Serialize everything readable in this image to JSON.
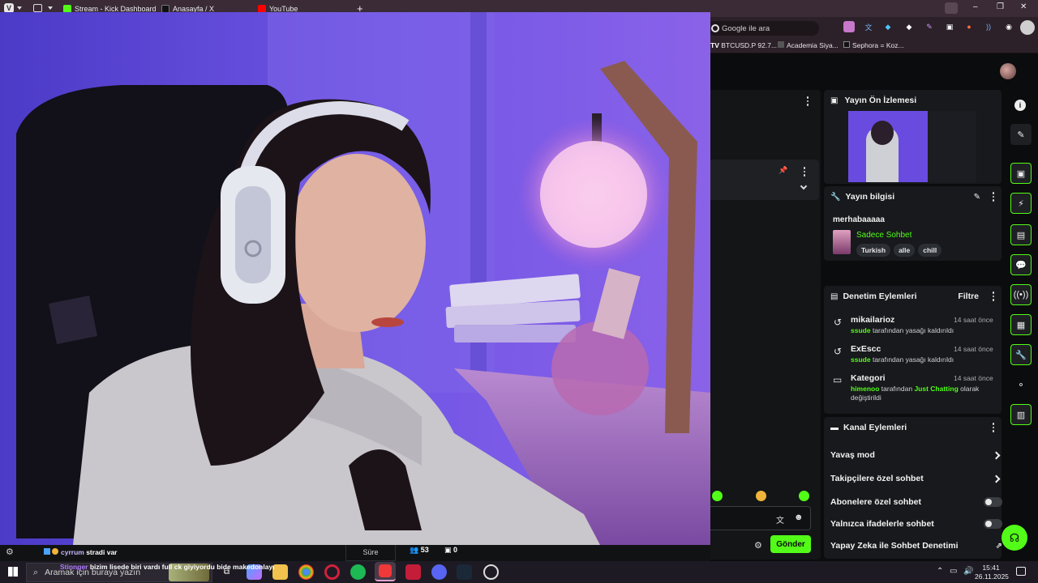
{
  "browser": {
    "tabs": [
      {
        "label": "Stream - Kick Dashboard",
        "color": "#53fc18"
      },
      {
        "label": "Anasayfa / X",
        "color": "#000000"
      },
      {
        "label": "YouTube",
        "color": "#ff0000"
      }
    ],
    "new_tab": "+",
    "search_placeholder": "Google ile ara",
    "bookmarks": [
      "BTCUSD.P 92.7...",
      "Academia Siya...",
      "Sephora = Koz..."
    ],
    "window_controls": {
      "minimize": "–",
      "restore": "❐",
      "close": "✕"
    }
  },
  "stream_preview": {
    "title": "Yayın Ön İzlemesi"
  },
  "stream_info": {
    "title": "Yayın bilgisi",
    "stream_title": "merhabaaaaa",
    "category": "Sadece Sohbet",
    "tags": [
      "Turkish",
      "alle",
      "chill"
    ]
  },
  "mod_actions": {
    "title": "Denetim Eylemleri",
    "filter_label": "Filtre",
    "items": [
      {
        "user": "mikailarioz",
        "ago": "14 saat önce",
        "actor": "ssude",
        "text": "tarafından yasağı kaldırıldı"
      },
      {
        "user": "ExEscc",
        "ago": "14 saat önce",
        "actor": "ssude",
        "text": "tarafından yasağı kaldırıldı"
      },
      {
        "user": "Kategori",
        "ago": "14 saat önce",
        "actor": "himenoo",
        "text_pre": "tarafından",
        "category": "Just Chatting",
        "text_post": "olarak değiştirildi"
      }
    ]
  },
  "channel_actions": {
    "title": "Kanal Eylemleri",
    "items": [
      {
        "label": "Yavaş mod",
        "control": "chevron"
      },
      {
        "label": "Takipçilere özel sohbet",
        "control": "chevron"
      },
      {
        "label": "Abonelere özel sohbet",
        "control": "toggle"
      },
      {
        "label": "Yalnızca ifadelerle sohbet",
        "control": "toggle"
      },
      {
        "label": "Yapay Zeka ile Sohbet Denetimi",
        "control": "external"
      }
    ]
  },
  "chat": {
    "send_label": "Gönder",
    "messages": [
      {
        "user": "cyrrum",
        "text": "stradi var",
        "user_color": "#ffffff"
      },
      {
        "user": "Stinnger",
        "text": "bizim lisede biri vardı full ck giyiyordu bide makedonlayı",
        "user_color": "#b07cff"
      }
    ],
    "stat_label": "Süre",
    "stat_a": "53",
    "stat_b": "0"
  },
  "taskbar": {
    "search_placeholder": "Aramak için buraya yazın",
    "time": "15:41",
    "date": "26.11.2025"
  },
  "colors": {
    "accent": "#53fc18",
    "panel": "#17191c",
    "background": "#0b0c0d"
  }
}
